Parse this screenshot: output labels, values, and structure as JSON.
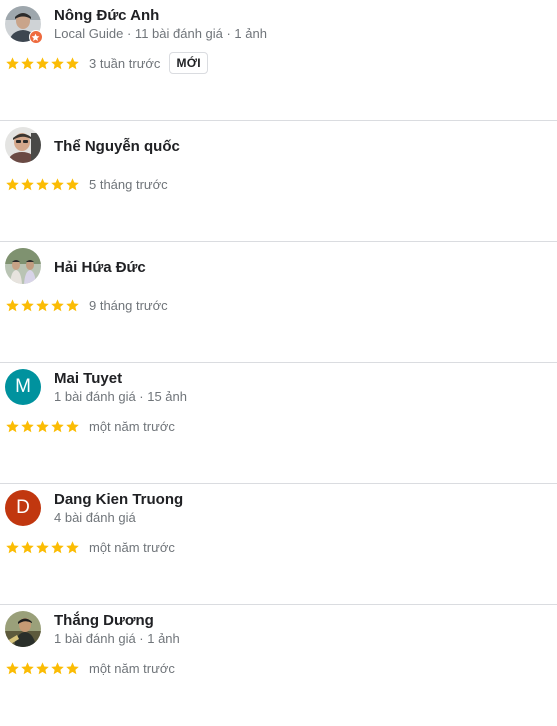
{
  "colors": {
    "star": "#fbbc04",
    "meta_text": "#70757a",
    "name_text": "#202124",
    "divider": "#dadce0",
    "local_guide_badge": "#ee6a3e"
  },
  "reviews": [
    {
      "name": "Nông Đức Anh",
      "meta": "Local Guide · 11 bài đánh giá · 1 ảnh",
      "rating": 5,
      "date": "3 tuần trước",
      "new_label": "MỚI",
      "avatar": {
        "kind": "photo",
        "icon": "user-photo-icon"
      },
      "badge_icon": "local-guide-star-icon"
    },
    {
      "name": "Thể Nguyễn quốc",
      "meta": "",
      "rating": 5,
      "date": "5 tháng trước",
      "avatar": {
        "kind": "photo",
        "icon": "user-photo-icon"
      }
    },
    {
      "name": "Hải Hứa Đức",
      "meta": "",
      "rating": 5,
      "date": "9 tháng trước",
      "avatar": {
        "kind": "photo",
        "icon": "user-photo-icon"
      }
    },
    {
      "name": "Mai Tuyet",
      "meta": "1 bài đánh giá · 15 ảnh",
      "rating": 5,
      "date": "một năm trước",
      "avatar": {
        "kind": "letter",
        "letter": "M",
        "color": "#00929e"
      }
    },
    {
      "name": "Dang Kien Truong",
      "meta": "4 bài đánh giá",
      "rating": 5,
      "date": "một năm trước",
      "avatar": {
        "kind": "letter",
        "letter": "D",
        "color": "#c1370f"
      }
    },
    {
      "name": "Thắng Dương",
      "meta": "1 bài đánh giá · 1 ảnh",
      "rating": 5,
      "date": "một năm trước",
      "avatar": {
        "kind": "photo",
        "icon": "user-photo-icon"
      }
    }
  ]
}
